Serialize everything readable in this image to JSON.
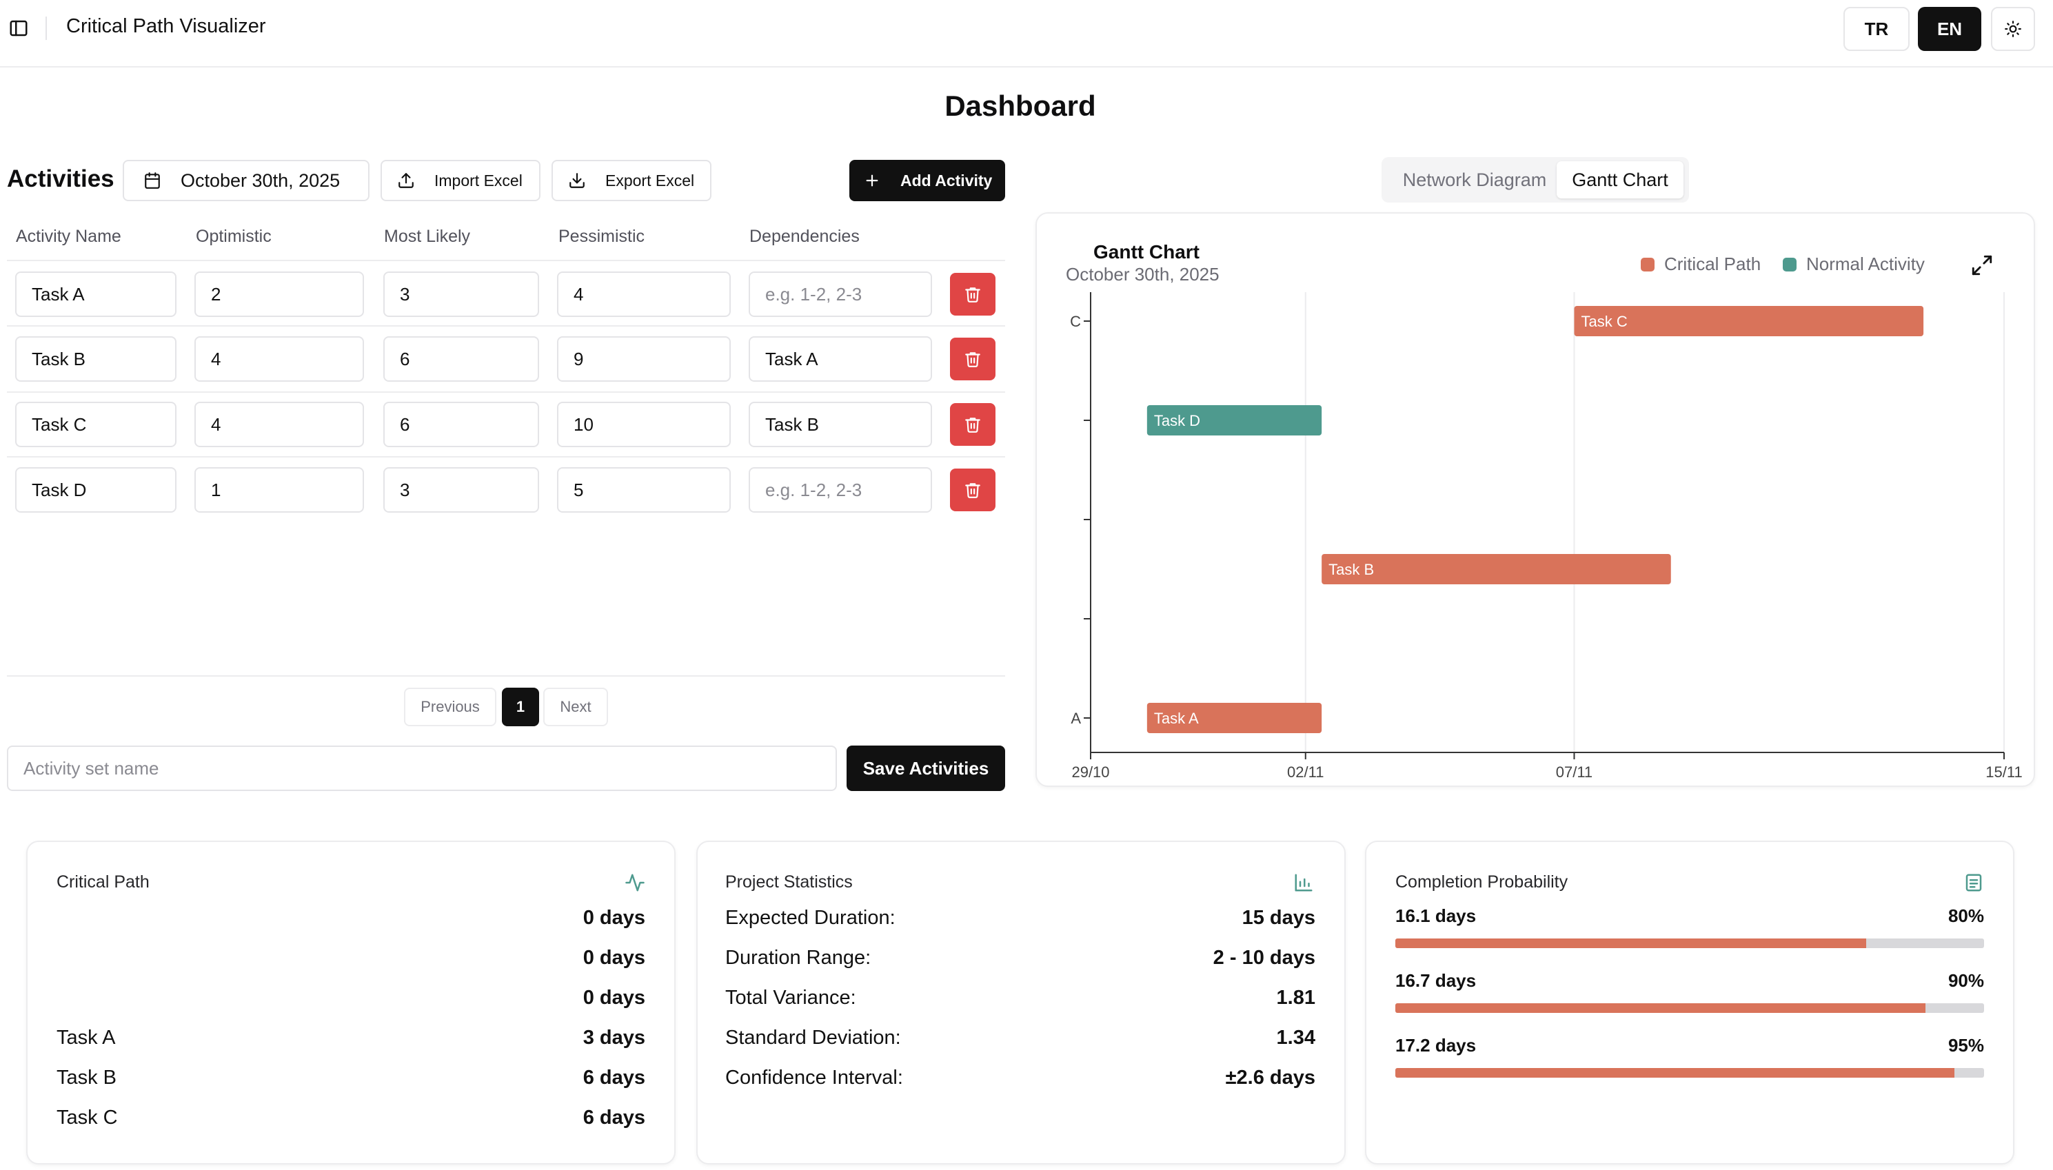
{
  "app": {
    "title": "Critical Path Visualizer",
    "lang_tr": "TR",
    "lang_en": "EN",
    "page_title": "Dashboard"
  },
  "activities": {
    "title": "Activities",
    "date": "October 30th, 2025",
    "import_label": "Import Excel",
    "export_label": "Export Excel",
    "add_label": "Add Activity",
    "columns": [
      "Activity Name",
      "Optimistic",
      "Most Likely",
      "Pessimistic",
      "Dependencies"
    ],
    "dependencies_placeholder": "e.g. 1-2, 2-3",
    "rows": [
      {
        "name": "Task A",
        "optimistic": "2",
        "most_likely": "3",
        "pessimistic": "4",
        "dependencies": ""
      },
      {
        "name": "Task B",
        "optimistic": "4",
        "most_likely": "6",
        "pessimistic": "9",
        "dependencies": "Task A"
      },
      {
        "name": "Task C",
        "optimistic": "4",
        "most_likely": "6",
        "pessimistic": "10",
        "dependencies": "Task B"
      },
      {
        "name": "Task D",
        "optimistic": "1",
        "most_likely": "3",
        "pessimistic": "5",
        "dependencies": ""
      }
    ],
    "pagination": {
      "previous": "Previous",
      "current": "1",
      "next": "Next"
    },
    "set_name_placeholder": "Activity set name",
    "save_label": "Save Activities"
  },
  "view_tabs": {
    "network": "Network Diagram",
    "gantt": "Gantt Chart",
    "selected": "gantt"
  },
  "gantt": {
    "title": "Gantt Chart",
    "date": "October 30th, 2025",
    "legend_critical": "Critical Path",
    "legend_normal": "Normal Activity",
    "critical_color": "#d9735a",
    "normal_color": "#4e9a8e"
  },
  "chart_data": {
    "type": "gantt",
    "x_ticks": [
      "29/10",
      "02/11",
      "07/11",
      "15/11"
    ],
    "x_tick_days": [
      0,
      4,
      9,
      17
    ],
    "x_range_days": [
      0,
      17
    ],
    "y_ticks": [
      "A",
      "",
      "",
      "",
      "C"
    ],
    "bars": [
      {
        "label": "Task C",
        "start_day": 9,
        "end_day": 15.5,
        "lane": 4,
        "critical": true
      },
      {
        "label": "Task D",
        "start_day": 1.05,
        "end_day": 4.3,
        "lane": 3,
        "critical": false
      },
      {
        "label": "Task B",
        "start_day": 4.3,
        "end_day": 10.8,
        "lane": 1.5,
        "critical": true
      },
      {
        "label": "Task A",
        "start_day": 1.05,
        "end_day": 4.3,
        "lane": 0,
        "critical": true
      }
    ],
    "grid": true
  },
  "critical_path": {
    "title": "Critical Path",
    "rows": [
      {
        "name": "",
        "value": "0 days"
      },
      {
        "name": "",
        "value": "0 days"
      },
      {
        "name": "",
        "value": "0 days"
      },
      {
        "name": "Task A",
        "value": "3 days"
      },
      {
        "name": "Task B",
        "value": "6 days"
      },
      {
        "name": "Task C",
        "value": "6 days"
      }
    ]
  },
  "project_statistics": {
    "title": "Project Statistics",
    "rows": [
      {
        "label": "Expected Duration:",
        "value": "15 days"
      },
      {
        "label": "Duration Range:",
        "value": "2 - 10 days"
      },
      {
        "label": "Total Variance:",
        "value": "1.81"
      },
      {
        "label": "Standard Deviation:",
        "value": "1.34"
      },
      {
        "label": "Confidence Interval:",
        "value": "±2.6 days"
      }
    ]
  },
  "completion_probability": {
    "title": "Completion Probability",
    "rows": [
      {
        "days": "16.1 days",
        "percent": "80%",
        "fill": 0.8
      },
      {
        "days": "16.7 days",
        "percent": "90%",
        "fill": 0.9
      },
      {
        "days": "17.2 days",
        "percent": "95%",
        "fill": 0.95
      }
    ]
  }
}
